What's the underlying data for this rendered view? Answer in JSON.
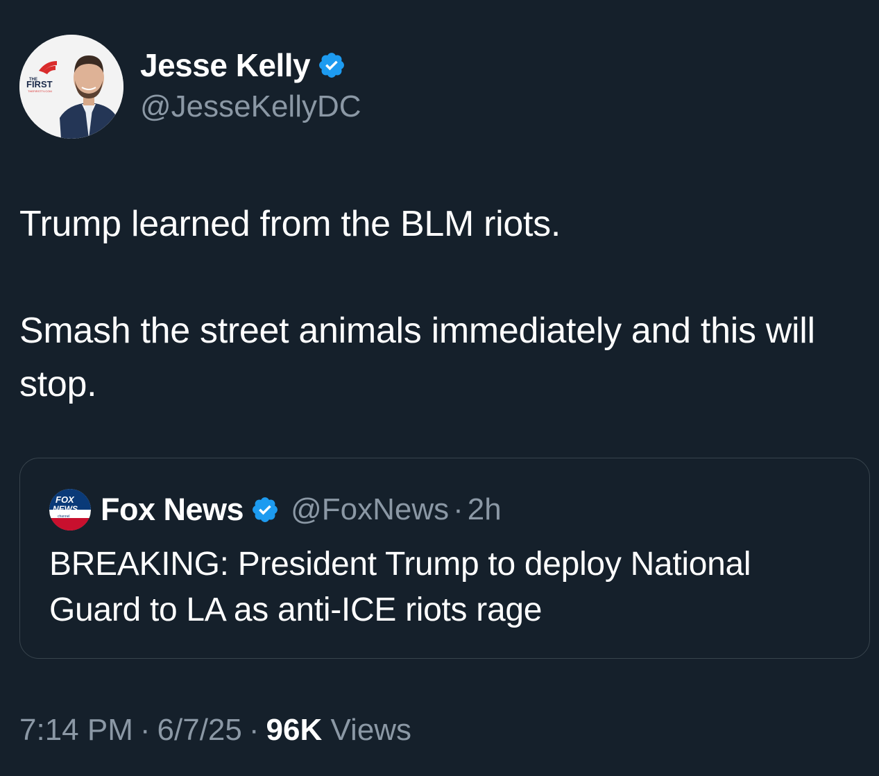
{
  "author": {
    "name": "Jesse Kelly",
    "handle": "@JesseKellyDC",
    "verified_icon": "verified-badge-icon",
    "avatar_logo_text": "FIRST"
  },
  "tweet": {
    "line1": "Trump learned from the BLM riots.",
    "line2": "Smash the street animals immediately and this will stop."
  },
  "quote": {
    "name": "Fox News",
    "handle": "@FoxNews",
    "separator": "·",
    "time": "2h",
    "text": "BREAKING: President Trump to deploy National Guard to LA as anti-ICE riots rage",
    "logo_text": "FOX NEWS channel"
  },
  "meta": {
    "time": "7:14 PM",
    "date": "6/7/25",
    "separator": "·",
    "views_count": "96K",
    "views_label": "Views"
  },
  "colors": {
    "background": "#15202b",
    "primary_text": "#ffffff",
    "secondary_text": "#8b98a5",
    "verified": "#1d9bf0",
    "border": "#38444d"
  }
}
